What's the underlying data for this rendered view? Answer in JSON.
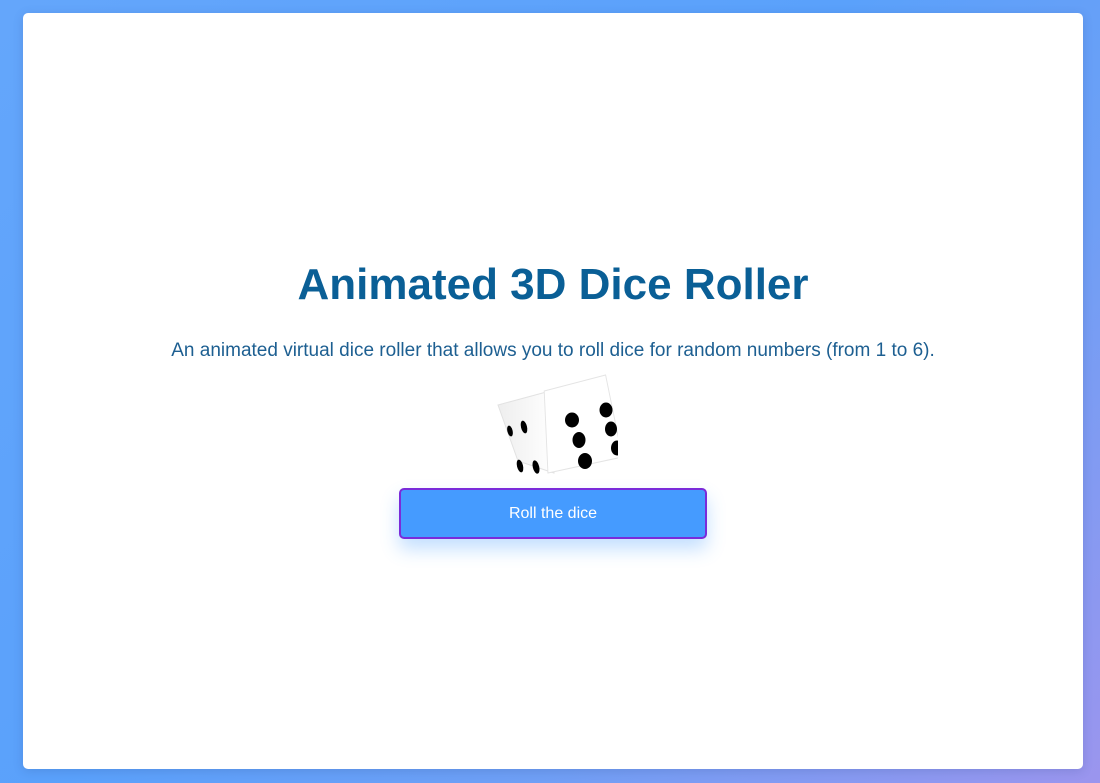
{
  "page": {
    "title": "Animated 3D Dice Roller",
    "subtitle": "An animated virtual dice roller that allows you to roll dice for random numbers (from 1 to 6).",
    "roll_button_label": "Roll the dice"
  },
  "dice": {
    "front_face_value": 5,
    "side_face_value": 4,
    "pip_color": "#000000",
    "face_color": "#ffffff"
  },
  "theme": {
    "title_color": "#0a5f96",
    "subtitle_color": "#1d5f91",
    "button_color": "#459bff",
    "button_border_color": "#7a2bd9",
    "background_gradient": [
      "#64a6fb",
      "#9b95ee"
    ]
  }
}
